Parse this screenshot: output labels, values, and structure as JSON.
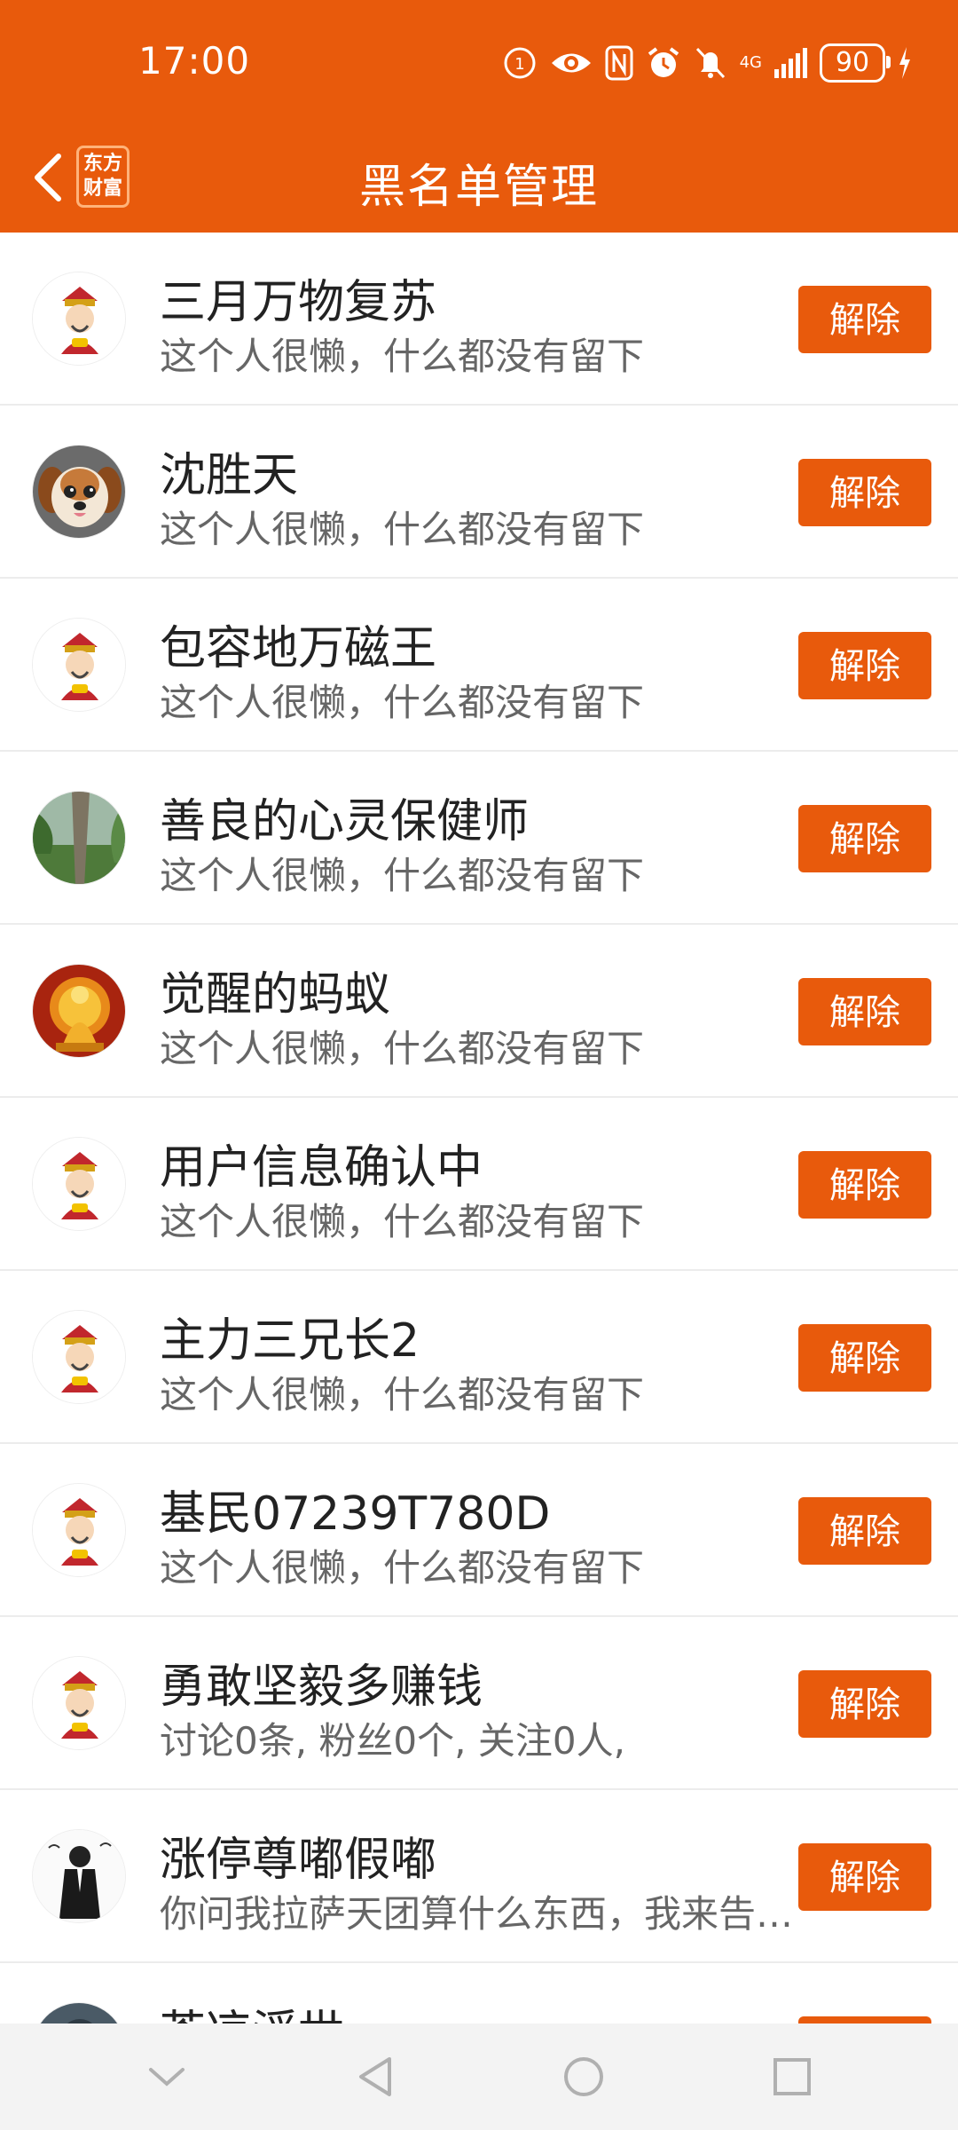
{
  "status_bar": {
    "time": "17:00",
    "network": "4G",
    "battery": "90"
  },
  "nav": {
    "title": "黑名单管理",
    "logo_line1": "东方",
    "logo_line2": "财富"
  },
  "accent_color": "#e85a0c",
  "blacklist": [
    {
      "name": "三月万物复苏",
      "desc": "这个人很懒，什么都没有留下",
      "button": "解除",
      "avatar": "god-of-wealth"
    },
    {
      "name": "沈胜天",
      "desc": "这个人很懒，什么都没有留下",
      "button": "解除",
      "avatar": "puppy"
    },
    {
      "name": "包容地万磁王",
      "desc": "这个人很懒，什么都没有留下",
      "button": "解除",
      "avatar": "god-of-wealth"
    },
    {
      "name": "善良的心灵保健师",
      "desc": "这个人很懒，什么都没有留下",
      "button": "解除",
      "avatar": "tree"
    },
    {
      "name": "觉醒的蚂蚁",
      "desc": "这个人很懒，什么都没有留下",
      "button": "解除",
      "avatar": "golden-buddha"
    },
    {
      "name": "用户信息确认中",
      "desc": "这个人很懒，什么都没有留下",
      "button": "解除",
      "avatar": "god-of-wealth"
    },
    {
      "name": "主力三兄长2",
      "desc": "这个人很懒，什么都没有留下",
      "button": "解除",
      "avatar": "god-of-wealth"
    },
    {
      "name": "基民07239T780D",
      "desc": "这个人很懒，什么都没有留下",
      "button": "解除",
      "avatar": "god-of-wealth"
    },
    {
      "name": "勇敢坚毅多赚钱",
      "desc": "讨论0条, 粉丝0个, 关注0人,",
      "button": "解除",
      "avatar": "god-of-wealth"
    },
    {
      "name": "涨停尊嘟假嘟",
      "desc": "你问我拉萨天团算什么东西，我来告诉你",
      "button": "解除",
      "avatar": "suit-figure"
    },
    {
      "name": "苍凉浮世",
      "desc": "",
      "button": "解除",
      "avatar": "dark"
    }
  ]
}
